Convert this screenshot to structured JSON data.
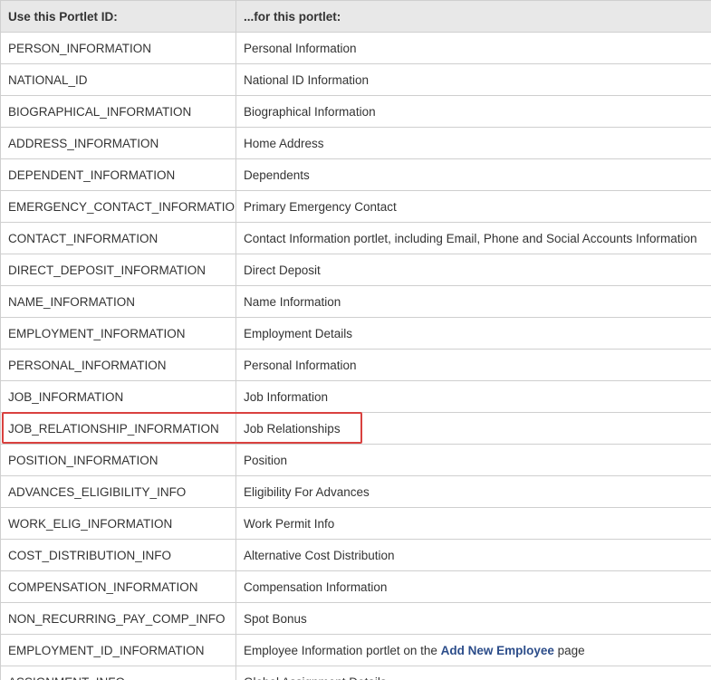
{
  "table": {
    "headers": [
      "Use this Portlet ID:",
      "...for this portlet:"
    ],
    "rows": [
      {
        "id": "PERSON_INFORMATION",
        "portlet": "Personal Information"
      },
      {
        "id": "NATIONAL_ID",
        "portlet": "National ID Information"
      },
      {
        "id": "BIOGRAPHICAL_INFORMATION",
        "portlet": "Biographical Information"
      },
      {
        "id": "ADDRESS_INFORMATION",
        "portlet": "Home Address"
      },
      {
        "id": "DEPENDENT_INFORMATION",
        "portlet": "Dependents"
      },
      {
        "id": "EMERGENCY_CONTACT_INFORMATION",
        "portlet": "Primary Emergency Contact"
      },
      {
        "id": "CONTACT_INFORMATION",
        "portlet": "Contact Information portlet, including Email, Phone and Social Accounts Information"
      },
      {
        "id": "DIRECT_DEPOSIT_INFORMATION",
        "portlet": "Direct Deposit"
      },
      {
        "id": "NAME_INFORMATION",
        "portlet": "Name Information"
      },
      {
        "id": "EMPLOYMENT_INFORMATION",
        "portlet": "Employment Details"
      },
      {
        "id": "PERSONAL_INFORMATION",
        "portlet": "Personal Information"
      },
      {
        "id": "JOB_INFORMATION",
        "portlet": "Job Information"
      },
      {
        "id": "JOB_RELATIONSHIP_INFORMATION",
        "portlet": "Job Relationships",
        "highlighted": true
      },
      {
        "id": "POSITION_INFORMATION",
        "portlet": "Position"
      },
      {
        "id": "ADVANCES_ELIGIBILITY_INFO",
        "portlet": "Eligibility For Advances"
      },
      {
        "id": "WORK_ELIG_INFORMATION",
        "portlet": "Work Permit Info"
      },
      {
        "id": "COST_DISTRIBUTION_INFO",
        "portlet": "Alternative Cost Distribution"
      },
      {
        "id": "COMPENSATION_INFORMATION",
        "portlet": "Compensation Information"
      },
      {
        "id": "NON_RECURRING_PAY_COMP_INFO",
        "portlet": "Spot Bonus"
      },
      {
        "id": "EMPLOYMENT_ID_INFORMATION",
        "portlet_prefix": "Employee Information portlet on the ",
        "portlet_link": "Add New Employee",
        "portlet_suffix": " page"
      },
      {
        "id": "ASSIGNMENT_INFO",
        "portlet": "Global Assignment Details"
      }
    ]
  },
  "colors": {
    "header_bg": "#e8e8e8",
    "border": "#cfcfcf",
    "highlight": "#d9413f",
    "link": "#2c4d8a"
  }
}
